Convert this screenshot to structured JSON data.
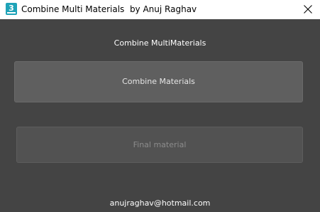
{
  "window": {
    "title": "Combine Multi Materials  by Anuj Raghav",
    "app_icon": "3ds-max-icon",
    "app_icon_glyph": "3",
    "close_icon": "close-icon"
  },
  "main": {
    "heading": "Combine MultiMaterials",
    "combine_button_label": "Combine Materials",
    "final_button_label": "Final material",
    "email": "anujraghav@hotmail.com"
  },
  "colors": {
    "background": "#444444",
    "button": "#5f5f5f",
    "button_disabled": "#525252",
    "disabled_text": "#8c8c8c"
  }
}
